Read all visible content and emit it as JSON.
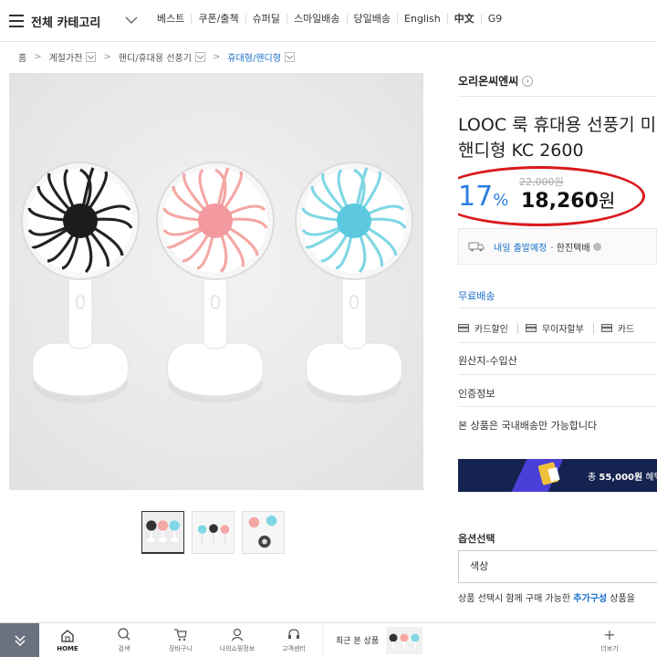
{
  "header": {
    "category_label": "전체 카테고리",
    "nav": [
      "베스트",
      "쿠폰/출첵",
      "슈퍼딜",
      "스마일배송",
      "당일배송",
      "English",
      "中文",
      "G9"
    ]
  },
  "breadcrumb": {
    "home": "홈",
    "items": [
      "계절가전",
      "핸디/휴대용 선풍기",
      "휴대형/핸디형"
    ]
  },
  "product": {
    "brand": "오리온씨엔씨",
    "title_line1": "LOOC 룩 휴대용 선풍기 미",
    "title_line2": "핸디형 KC 2600",
    "original_price": "22,000원",
    "discount_value": "17",
    "discount_unit": "%",
    "price_value": "18,260",
    "price_unit": "원"
  },
  "shipping": {
    "eta": "내일 출발예정",
    "carrier": "· 한진택배",
    "free_shipping": "무료배송"
  },
  "payment": [
    "카드할인",
    "무이자할부",
    "카드"
  ],
  "info": {
    "origin": "원산지-수입산",
    "certification": "인증정보",
    "domestic": "본 상품은 국내배송만 가능합니다"
  },
  "banner": {
    "prefix": "총 ",
    "amount": "55,000원",
    "suffix": " 혜택"
  },
  "options": {
    "label": "옵션선택",
    "select_value": "색상",
    "note_prefix": "상품 선택시 함께 구매 가능한 ",
    "note_link": "추가구성",
    "note_suffix": " 상품을"
  },
  "bottom_bar": {
    "items": [
      "HOME",
      "검색",
      "장바구니",
      "나의쇼핑정보",
      "고객센터"
    ],
    "recent_label": "최근 본 상품",
    "more_label": "더보기"
  },
  "colors": {
    "accent_blue": "#2c7fe0",
    "highlight_red": "#d9191d",
    "fan_black": "#222222",
    "fan_pink": "#f4a7a4",
    "fan_blue": "#7fd7e4"
  }
}
